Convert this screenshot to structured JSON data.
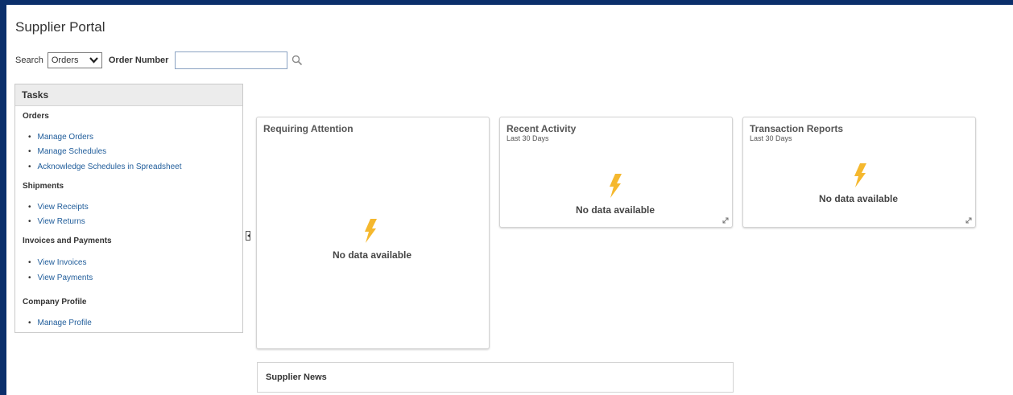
{
  "page": {
    "title": "Supplier Portal"
  },
  "search": {
    "label": "Search",
    "selected_option": "Orders",
    "order_number_label": "Order Number",
    "order_number_value": ""
  },
  "tasks": {
    "header": "Tasks",
    "orders": {
      "label": "Orders",
      "items": [
        "Manage Orders",
        "Manage Schedules",
        "Acknowledge Schedules in Spreadsheet"
      ]
    },
    "shipments": {
      "label": "Shipments",
      "items": [
        "View Receipts",
        "View Returns"
      ]
    },
    "invoices": {
      "label": "Invoices and Payments",
      "items": [
        "View Invoices",
        "View Payments"
      ]
    },
    "profile": {
      "label": "Company Profile",
      "items": [
        "Manage Profile"
      ]
    }
  },
  "cards": {
    "requiring_attention": {
      "title": "Requiring Attention",
      "empty": "No data available"
    },
    "recent_activity": {
      "title": "Recent Activity",
      "subtitle": "Last 30 Days",
      "empty": "No data available"
    },
    "transaction_reports": {
      "title": "Transaction Reports",
      "subtitle": "Last 30 Days",
      "empty": "No data available"
    }
  },
  "news": {
    "title": "Supplier News"
  },
  "colors": {
    "nav_bar": "#0b2f6b",
    "link": "#1f5c9a",
    "bolt": "#f5b82e"
  },
  "icons": {
    "search": "magnifier-icon",
    "dropdown": "chevron-down-icon",
    "empty_state": "lightning-bolt-icon",
    "expand": "expand-icon",
    "collapse": "collapse-panel-icon"
  }
}
